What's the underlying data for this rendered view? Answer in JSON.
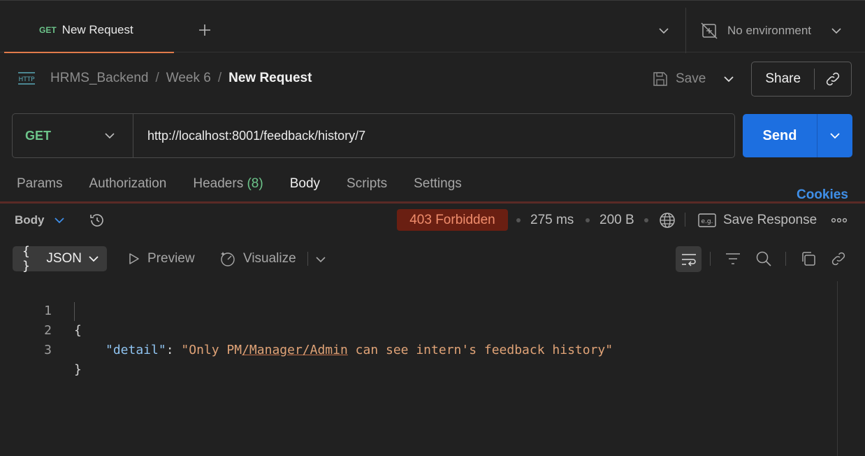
{
  "tab": {
    "method": "GET",
    "title": "New Request"
  },
  "environment": {
    "label": "No environment"
  },
  "breadcrumb": {
    "icon_text": "HTTP",
    "collection": "HRMS_Backend",
    "sep": "/",
    "folder": "Week 6",
    "current": "New Request"
  },
  "actions": {
    "save_label": "Save",
    "share_label": "Share"
  },
  "request": {
    "method": "GET",
    "url": "http://localhost:8001/feedback/history/7",
    "send_label": "Send"
  },
  "request_tabs": [
    {
      "label": "Params"
    },
    {
      "label": "Authorization"
    },
    {
      "label": "Headers",
      "count": "(8)"
    },
    {
      "label": "Body",
      "active": true
    },
    {
      "label": "Scripts"
    },
    {
      "label": "Settings"
    }
  ],
  "cookies_label": "Cookies",
  "response": {
    "body_label": "Body",
    "status": "403 Forbidden",
    "time": "275 ms",
    "size": "200 B",
    "save_response_label": "Save Response",
    "format_label": "JSON",
    "preview_label": "Preview",
    "visualize_label": "Visualize"
  },
  "code_lines": [
    {
      "num": "1",
      "text": "{"
    },
    {
      "num": "2",
      "key": "\"detail\"",
      "colon": ": ",
      "value_pre": "\"Only PM",
      "value_ul": "/Manager/Admin",
      "value_post": " can see intern's feedback history\""
    },
    {
      "num": "3",
      "text": "}"
    }
  ],
  "colors": {
    "accent_send": "#1d6fe0",
    "get_method": "#6cc48a",
    "status_bg": "#6a1f12",
    "status_text": "#f08d6c",
    "cookies": "#3f8fe8"
  }
}
